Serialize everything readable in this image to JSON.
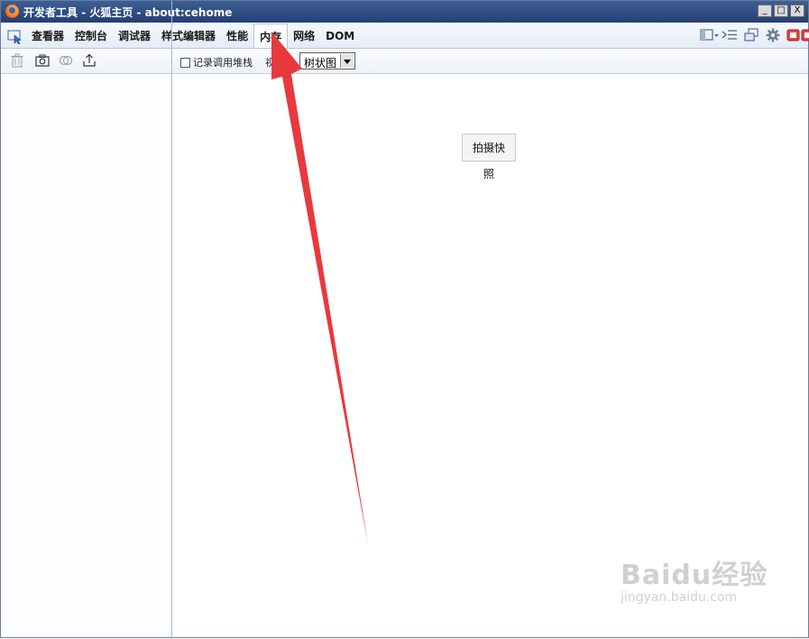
{
  "window": {
    "title": "开发者工具 - 火狐主页 - about:cehome",
    "controls": {
      "minimize": "_",
      "maximize": "□",
      "close": "X"
    }
  },
  "tabs": [
    {
      "label": "查看器"
    },
    {
      "label": "控制台"
    },
    {
      "label": "调试器"
    },
    {
      "label": "样式编辑器"
    },
    {
      "label": "性能"
    },
    {
      "label": "内存",
      "active": true
    },
    {
      "label": "网络"
    },
    {
      "label": "DOM"
    }
  ],
  "toolbar": {
    "record_label": "记录调用堆栈",
    "view_label": "视图:",
    "view_value": "树状图"
  },
  "main": {
    "snapshot_button": "拍摄快照"
  },
  "watermark": {
    "main": "Baidu经验",
    "sub": "jingyan.baidu.com"
  },
  "colors": {
    "annotation_arrow": "#e8393c",
    "titlebar": "#2f4f86"
  }
}
